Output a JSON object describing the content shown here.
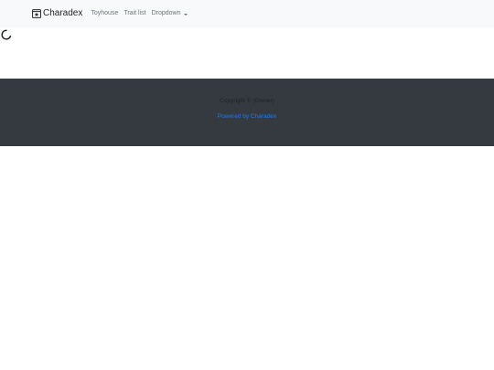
{
  "navbar": {
    "brand": {
      "icon": "card-box-icon",
      "label": "Charadex"
    },
    "links": [
      {
        "label": "Toyhouse"
      },
      {
        "label": "Trait list"
      }
    ],
    "dropdown": {
      "label": "Dropdown",
      "icon": "caret-down-icon"
    }
  },
  "content": {
    "loading_icon": "loading-spinner-icon"
  },
  "footer": {
    "copyright": "Copyright © (Owner)",
    "powered_prefix": "Powered by",
    "powered_link": "Charadex"
  },
  "colors": {
    "navbar_bg": "#f8f9fa",
    "footer_bg": "#343a40",
    "link_blue": "#1a7cf2",
    "nav_text": "#6c757d"
  }
}
